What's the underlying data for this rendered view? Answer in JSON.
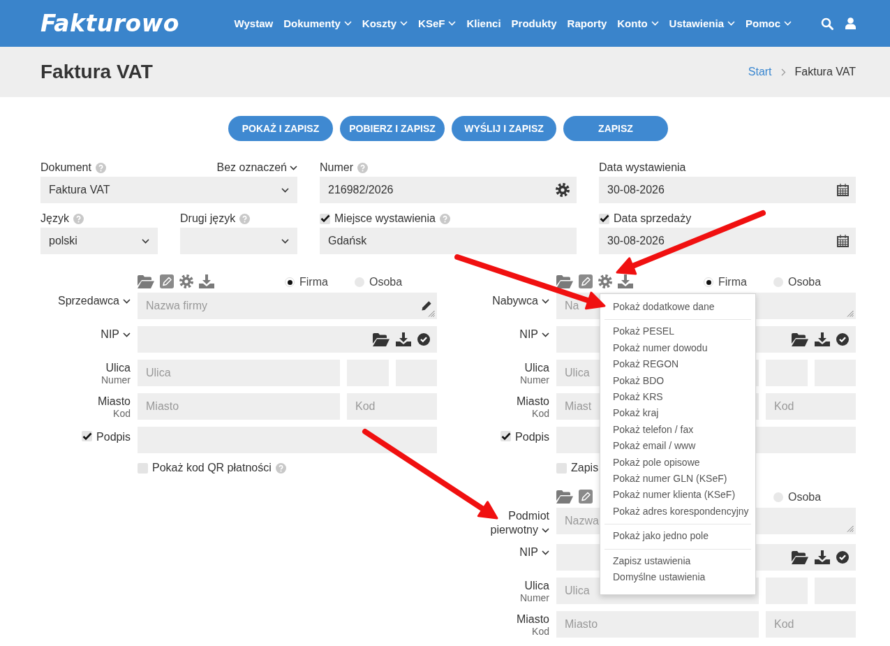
{
  "header": {
    "logo": "Fakturowo",
    "nav": [
      {
        "label": "Wystaw",
        "has_menu": false
      },
      {
        "label": "Dokumenty",
        "has_menu": true
      },
      {
        "label": "Koszty",
        "has_menu": true
      },
      {
        "label": "KSeF",
        "has_menu": true
      },
      {
        "label": "Klienci",
        "has_menu": false
      },
      {
        "label": "Produkty",
        "has_menu": false
      },
      {
        "label": "Raporty",
        "has_menu": false
      },
      {
        "label": "Konto",
        "has_menu": true
      },
      {
        "label": "Ustawienia",
        "has_menu": true
      },
      {
        "label": "Pomoc",
        "has_menu": true
      }
    ]
  },
  "page_title": "Faktura VAT",
  "breadcrumb": [
    {
      "label": "Start",
      "link": true
    },
    {
      "label": "Faktura VAT",
      "link": false
    }
  ],
  "actions": [
    "POKAŻ I ZAPISZ",
    "POBIERZ I ZAPISZ",
    "WYŚLIJ I ZAPISZ",
    "ZAPISZ"
  ],
  "document": {
    "type": {
      "label": "Dokument",
      "help": true,
      "value": "Faktura VAT"
    },
    "marking": "Bez oznaczeń",
    "number": {
      "label": "Numer",
      "help": true,
      "value": "216982/2026"
    },
    "issue_date": {
      "label": "Data wystawienia",
      "help": false,
      "value": "30-08-2026"
    },
    "language": {
      "label": "Język",
      "help": true,
      "value": "polski"
    },
    "second_language": {
      "label": "Drugi język",
      "help": true
    },
    "place": {
      "label": "Miejsce wystawienia",
      "help": true,
      "checked": true,
      "value": "Gdańsk"
    },
    "sale_date": {
      "label": "Data sprzedaży",
      "help": false,
      "checked": true,
      "value": "30-08-2026"
    }
  },
  "seller": {
    "label": "Sprzedawca",
    "tools": [
      {
        "kind": "folder"
      },
      {
        "kind": "edit"
      },
      {
        "kind": "settings"
      },
      {
        "kind": "download"
      }
    ],
    "types": [
      {
        "label": "Firma",
        "selected": true
      },
      {
        "label": "Osoba",
        "selected": false
      }
    ],
    "name": {
      "placeholder": "Nazwa firmy",
      "edit_icon": true
    },
    "nip": {
      "label": "NIP"
    },
    "street": {
      "label": "Ulica",
      "sublabel": "Numer",
      "placeholder": "Ulica"
    },
    "city": {
      "label": "Miasto",
      "sublabel": "Kod",
      "placeholder": "Miasto",
      "postcode_placeholder": "Kod"
    },
    "signature": {
      "label": "Podpis",
      "checked": true
    },
    "option": {
      "label": "Pokaż kod QR płatności",
      "checked": false,
      "help": true
    }
  },
  "buyer": {
    "label": "Nabywca",
    "tools": [
      {
        "kind": "folder"
      },
      {
        "kind": "edit"
      },
      {
        "kind": "settings"
      },
      {
        "kind": "download"
      }
    ],
    "types": [
      {
        "label": "Firma",
        "selected": true
      },
      {
        "label": "Osoba",
        "selected": false
      }
    ],
    "name": {
      "placeholder": "Na",
      "edit_icon": false
    },
    "nip": {
      "label": "NIP"
    },
    "street": {
      "label": "Ulica",
      "sublabel": "Numer",
      "placeholder": "Ulica"
    },
    "city": {
      "label": "Miasto",
      "sublabel": "Kod",
      "placeholder": "Miast",
      "postcode_placeholder": "Kod"
    },
    "signature": {
      "label": "Podpis",
      "checked": true
    },
    "option": {
      "label": "Zapis",
      "checked": false,
      "help": false
    }
  },
  "primary_entity": {
    "label": "Podmiot pierwotny",
    "tools": [
      {
        "kind": "folder"
      },
      {
        "kind": "edit"
      }
    ],
    "types": [
      {
        "label": "Osoba",
        "selected": false
      }
    ],
    "name": {
      "placeholder": "Nazwa",
      "edit_icon": false
    },
    "nip": {
      "label": "NIP"
    },
    "street": {
      "label": "Ulica",
      "sublabel": "Numer",
      "placeholder": "Ulica"
    },
    "city": {
      "label": "Miasto",
      "sublabel": "Kod",
      "placeholder": "Miasto",
      "postcode_placeholder": "Kod"
    }
  },
  "context_menu": {
    "groups": [
      [
        "Pokaż dodatkowe dane"
      ],
      [
        "Pokaż PESEL",
        "Pokaż numer dowodu",
        "Pokaż REGON",
        "Pokaż BDO",
        "Pokaż KRS",
        "Pokaż kraj",
        "Pokaż telefon / fax",
        "Pokaż email / www",
        "Pokaż pole opisowe",
        "Pokaż numer GLN (KSeF)",
        "Pokaż numer klienta (KSeF)",
        "Pokaż adres korespondencyjny"
      ],
      [
        "Pokaż jako jedno pole"
      ],
      [
        "Zapisz ustawienia",
        "Domyślne ustawienia"
      ]
    ]
  }
}
